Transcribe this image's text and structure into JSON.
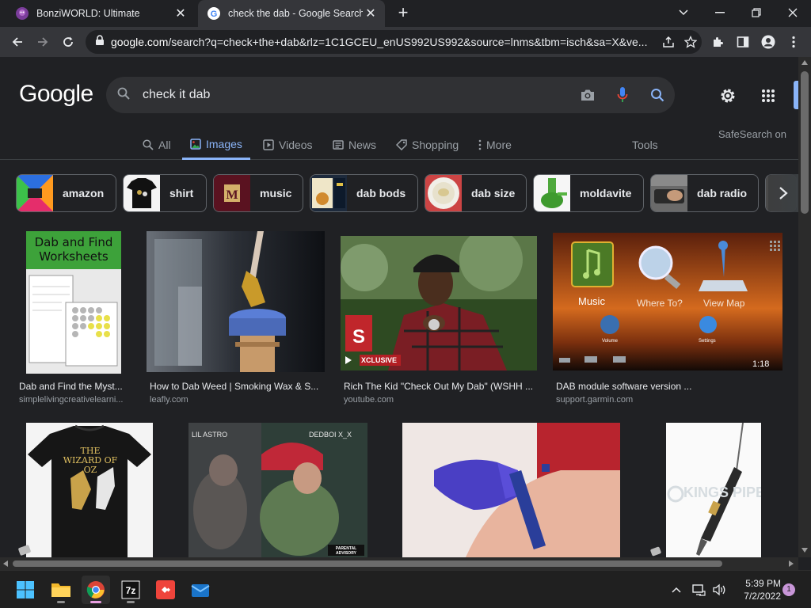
{
  "tabs": [
    {
      "title": "BonziWORLD: Ultimate",
      "active": false
    },
    {
      "title": "check the dab - Google Search",
      "active": true
    }
  ],
  "address_bar": {
    "url_host": "google.com",
    "url_rest": "/search?q=check+the+dab&rlz=1C1GCEU_enUS992US992&source=lnms&tbm=isch&sa=X&ve..."
  },
  "google": {
    "logo": "Google",
    "query": "check it dab",
    "safesearch": "SafeSearch on",
    "tabs": [
      "All",
      "Images",
      "Videos",
      "News",
      "Shopping",
      "More"
    ],
    "tools": "Tools"
  },
  "chips": [
    "amazon",
    "shirt",
    "music",
    "dab bods",
    "dab size",
    "moldavite",
    "dab radio"
  ],
  "results": [
    {
      "caption": "Dab and Find the Myst...",
      "source": "simplelivingcreativelearni...",
      "overlay_title": "Dab and Find Worksheets"
    },
    {
      "caption": "How to Dab Weed | Smoking Wax & S...",
      "source": "leafly.com"
    },
    {
      "caption": "Rich The Kid \"Check Out My Dab\" (WSHH ...",
      "source": "youtube.com",
      "overlay_badge": "XCLUSIVE"
    },
    {
      "caption": "DAB module software version ...",
      "source": "support.garmin.com",
      "overlay_music": "Music",
      "overlay_where": "Where To?",
      "overlay_map": "View Map",
      "overlay_volume": "Volume",
      "overlay_settings": "Settings",
      "overlay_time": "1:18"
    },
    {
      "caption": "",
      "source": "",
      "overlay_title": "THE WIZARD OF OZ"
    },
    {
      "caption": "",
      "source": "",
      "overlay_left": "LIL ASTRO",
      "overlay_right": "DEDBOI X_X",
      "overlay_advisory": "PARENTAL ADVISORY"
    },
    {
      "caption": "",
      "source": ""
    },
    {
      "caption": "",
      "source": "",
      "overlay_watermark": "KINGS PIPE"
    }
  ],
  "taskbar": {
    "time": "5:39 PM",
    "date": "7/2/2022",
    "notifications": "1"
  },
  "colors": {
    "accent": "#8ab4f8",
    "background": "#202124",
    "search_box": "#303134"
  }
}
